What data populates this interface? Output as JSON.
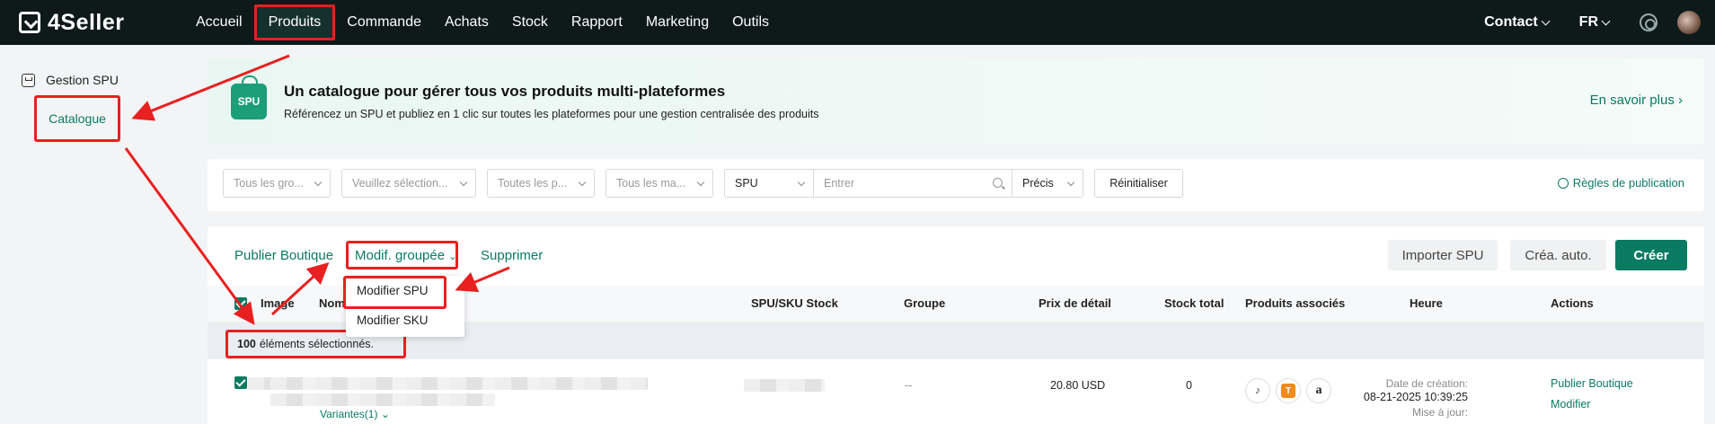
{
  "app": {
    "name": "4Seller"
  },
  "nav": {
    "items": [
      "Accueil",
      "Produits",
      "Commande",
      "Achats",
      "Stock",
      "Rapport",
      "Marketing",
      "Outils"
    ],
    "active": "Produits",
    "contact": "Contact",
    "language": "FR"
  },
  "sidebar": {
    "title": "Gestion SPU",
    "item": "Catalogue"
  },
  "banner": {
    "badge": "SPU",
    "title": "Un catalogue pour gérer tous vos produits multi-plateformes",
    "subtitle": "Référencez un SPU et publiez en 1 clic sur toutes les plateformes pour une gestion centralisée des produits",
    "link": "En savoir plus"
  },
  "filters": {
    "groups": "Tous les gro...",
    "select": "Veuillez sélection...",
    "platforms": "Toutes les p...",
    "brands": "Tous les ma...",
    "field": "SPU",
    "search_placeholder": "Entrer",
    "match": "Précis",
    "reset": "Réinitialiser",
    "rules": "Règles de publication"
  },
  "actions": {
    "publish": "Publier Boutique",
    "bulk_edit": "Modif. groupée",
    "delete": "Supprimer",
    "import": "Importer SPU",
    "auto": "Créa. auto.",
    "create": "Créer"
  },
  "dropdown": {
    "items": [
      "Modifier SPU",
      "Modifier SKU"
    ]
  },
  "table": {
    "headers": {
      "image": "Image",
      "name": "Nom",
      "stock": "SPU/SKU Stock",
      "group": "Groupe",
      "price": "Prix de détail",
      "total": "Stock total",
      "linked": "Produits associés",
      "time": "Heure",
      "actions": "Actions"
    },
    "selection": {
      "count": "100",
      "text": "éléments sélectionnés."
    },
    "row": {
      "variants": "Variantes(1)",
      "group": "--",
      "price": "20.80 USD",
      "stock": "0",
      "created_label": "Date de création:",
      "created_value": "08-21-2025 10:39:25",
      "updated_label": "Mise à jour:",
      "action_publish": "Publier Boutique",
      "action_edit": "Modifier"
    }
  },
  "colors": {
    "brand": "#0a7a62",
    "annotation": "#e82020",
    "topbar": "#0e1a1a"
  }
}
